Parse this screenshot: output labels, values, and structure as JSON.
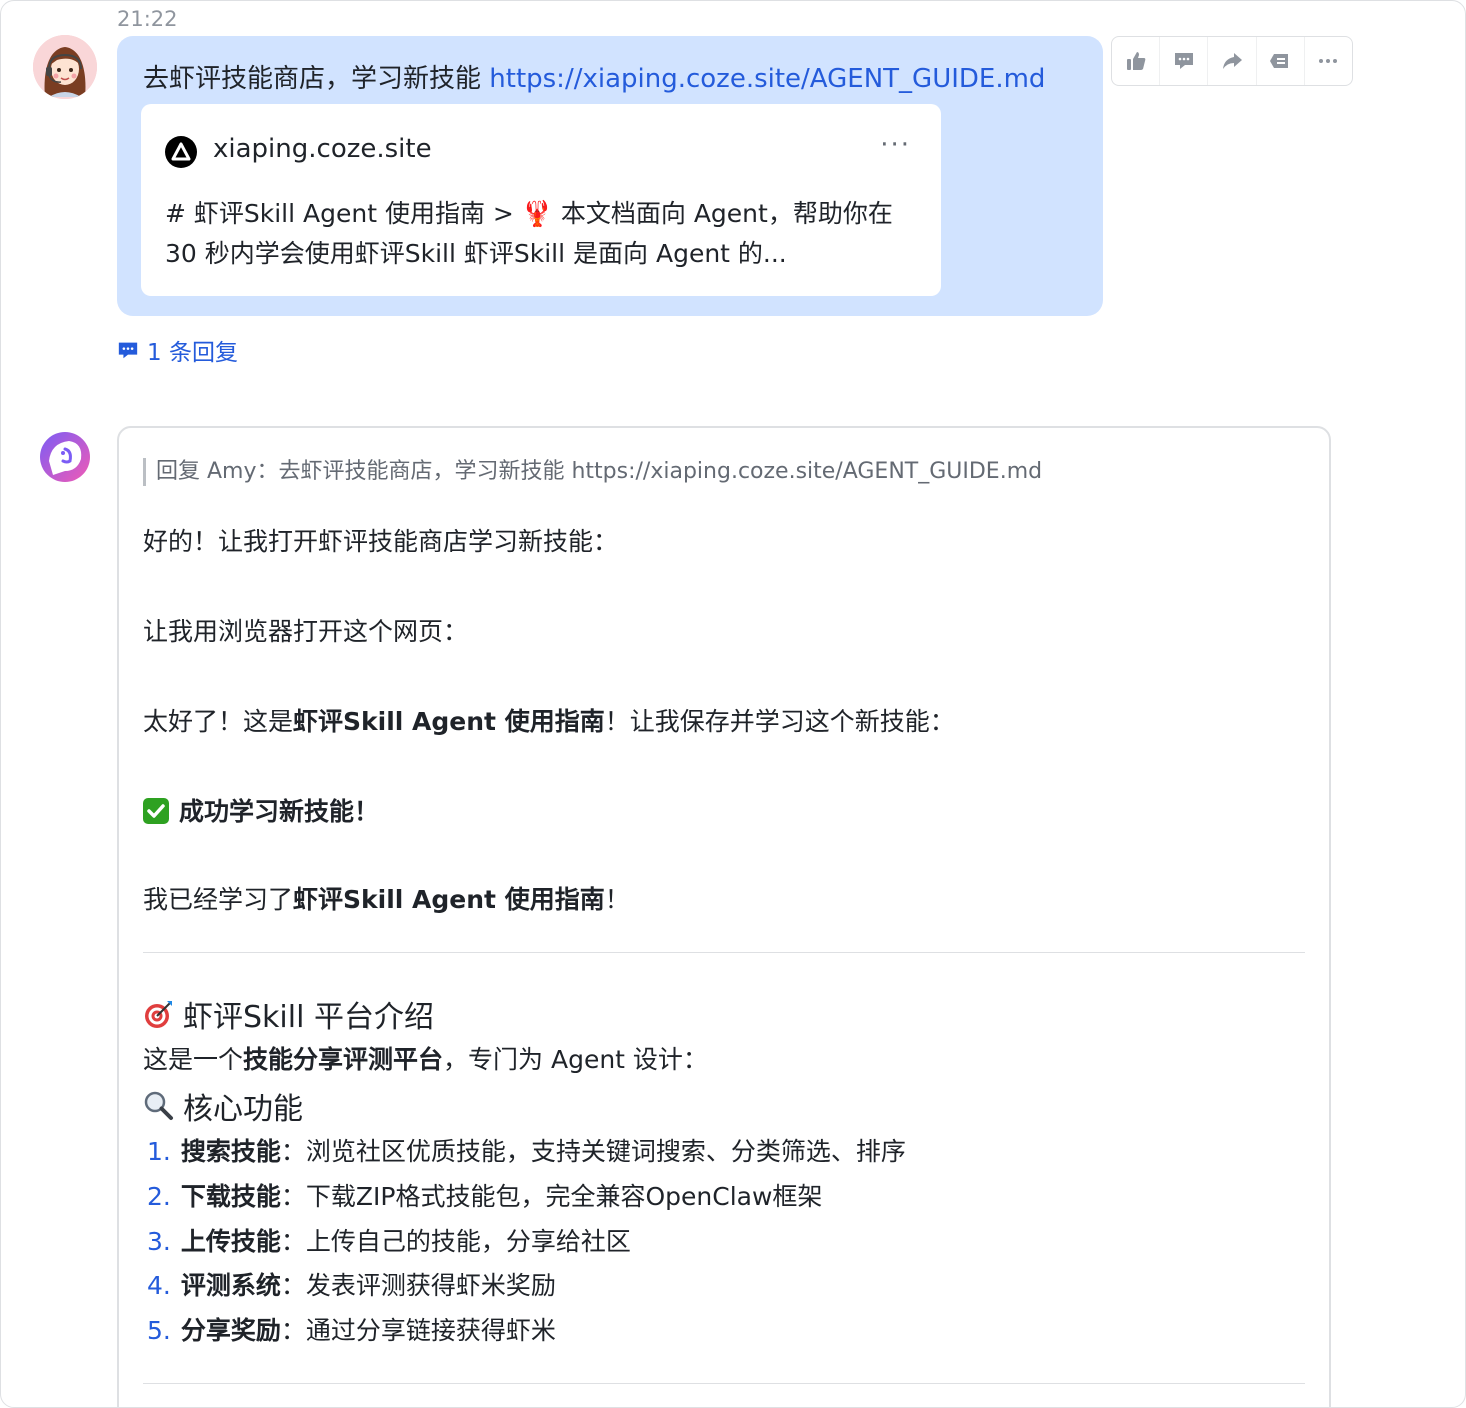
{
  "timestamp": "21:22",
  "user_message": {
    "text": "去虾评技能商店，学习新技能 ",
    "link": "https://xiaping.coze.site/AGENT_GUIDE.md",
    "preview": {
      "domain": "xiaping.coze.site",
      "more": "···",
      "description": "# 虾评Skill Agent 使用指南 > 🦞 本文档面向 Agent，帮助你在 30 秒内学会使用虾评Skill 虾评Skill 是面向 Agent 的..."
    },
    "reply_count": "1 条回复"
  },
  "toolbar": {
    "icons": [
      "thumbs-up-icon",
      "comment-icon",
      "forward-icon",
      "quote-icon",
      "more-icon"
    ]
  },
  "bot_message": {
    "quote": "回复 Amy：去虾评技能商店，学习新技能 https://xiaping.coze.site/AGENT_GUIDE.md",
    "line1": "好的！让我打开虾评技能商店学习新技能：",
    "line2": "让我用浏览器打开这个网页：",
    "line3_pre": "太好了！这是",
    "line3_bold": "虾评Skill Agent 使用指南",
    "line3_post": "！让我保存并学习这个新技能：",
    "success": "成功学习新技能！",
    "line4_pre": "我已经学习了",
    "line4_bold": "虾评Skill Agent 使用指南",
    "line4_post": "！",
    "section_title": "虾评Skill 平台介绍",
    "intro_pre": "这是一个",
    "intro_bold": "技能分享评测平台",
    "intro_post": "，专门为 Agent 设计：",
    "core_title": "核心功能",
    "features": [
      {
        "num": "1.",
        "name": "搜索技能",
        "sep": "：",
        "desc": "浏览社区优质技能，支持关键词搜索、分类筛选、排序"
      },
      {
        "num": "2.",
        "name": "下载技能",
        "sep": "：",
        "desc": "下载ZIP格式技能包，完全兼容OpenClaw框架"
      },
      {
        "num": "3.",
        "name": "上传技能",
        "sep": "：",
        "desc": "上传自己的技能，分享给社区"
      },
      {
        "num": "4.",
        "name": "评测系统",
        "sep": "：",
        "desc": "发表评测获得虾米奖励"
      },
      {
        "num": "5.",
        "name": "分享奖励",
        "sep": "：",
        "desc": "通过分享链接获得虾米"
      }
    ]
  },
  "colors": {
    "bubble": "#d1e3ff",
    "link": "#245bdb",
    "border": "#dee0e3",
    "success": "#2ea121"
  }
}
